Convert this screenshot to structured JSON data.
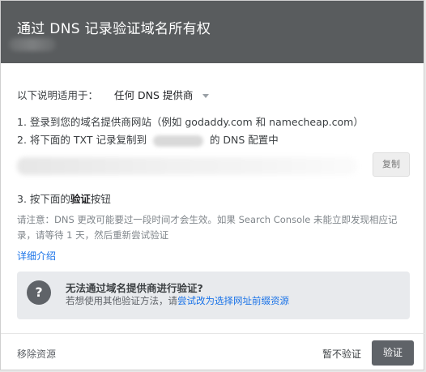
{
  "dialog": {
    "title": "通过 DNS 记录验证域名所有权"
  },
  "applies": {
    "label": "以下说明适用于：",
    "provider_value": "任何 DNS 提供商"
  },
  "steps": {
    "step1": "1. 登录到您的域名提供商网站（例如 godaddy.com 和 namecheap.com）",
    "step2_prefix": "2. 将下面的 TXT 记录复制到",
    "step2_suffix": "的 DNS 配置中",
    "copy_label": "复制",
    "step3_prefix": "3. 按下面的",
    "step3_bold": "验证",
    "step3_suffix": "按钮"
  },
  "note": {
    "line1": "请注意：DNS 更改可能要过一段时间才会生效。如果 Search Console 未能立即发现相应记",
    "line2": "录，请等待 1 天，然后重新尝试验证"
  },
  "learn_more": "详细介绍",
  "help": {
    "icon_glyph": "?",
    "title": "无法通过域名提供商进行验证?",
    "text_prefix": "若想使用其他验证方法，请",
    "text_link": "尝试改为选择网址前缀资源"
  },
  "footer": {
    "remove_label": "移除资源",
    "skip_label": "暂不验证",
    "verify_label": "验证"
  },
  "colors": {
    "header_bg": "#595c5e",
    "link": "#1a73e8",
    "primary_button": "#5f6368"
  }
}
